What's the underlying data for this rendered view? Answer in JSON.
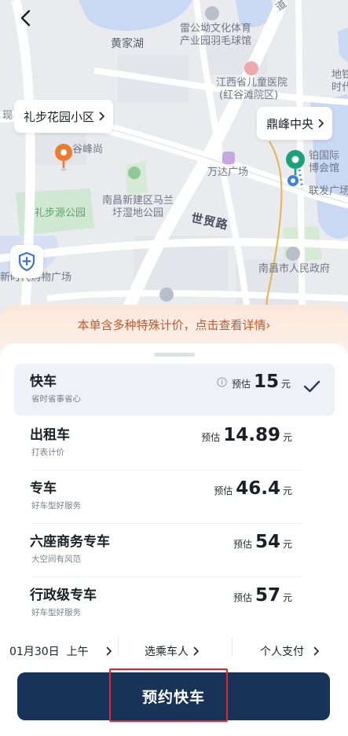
{
  "map": {
    "labels": {
      "huangjiahu": "黄家湖",
      "leigong_line1": "雷公坳文化体育",
      "leigong_line2": "产业园羽毛球馆",
      "hospital_line1": "江西省儿童医院",
      "hospital_line2": "(红谷滩院区)",
      "ditie_line1": "地铁",
      "ditie_line2": "时代",
      "xian": "现",
      "gufeng": "谷峰尚",
      "wanda": "万达广场",
      "expo_line1": "铂国际",
      "expo_line2": "博会馆",
      "lianfa": "联发广场",
      "wetland_line1": "南昌新建区马兰",
      "wetland_line2": "圩湿地公园",
      "shimao": "世贸路",
      "lbpark": "礼步源公园",
      "plaza": "新时代购物广场",
      "gov": "南昌市人民政府",
      "top_road": "道"
    },
    "origin_chip": "礼步花园小区",
    "dest_chip": "鼎峰中央"
  },
  "promo": {
    "text": "本单含多种特殊计价，点击查看详情",
    "chevron": "›"
  },
  "rides": [
    {
      "name": "快车",
      "sub": "省时省事省心",
      "est": "预估",
      "price": "15",
      "unit": "元",
      "selected": true
    },
    {
      "name": "出租车",
      "sub": "打表计价",
      "est": "预估",
      "price": "14.89",
      "unit": "元",
      "selected": false
    },
    {
      "name": "专车",
      "sub": "好车型好服务",
      "est": "预估",
      "price": "46.4",
      "unit": "元",
      "selected": false
    },
    {
      "name": "六座商务专车",
      "sub": "大空间有风范",
      "est": "预估",
      "price": "54",
      "unit": "元",
      "selected": false
    },
    {
      "name": "行政级专车",
      "sub": "好车型好服务",
      "est": "预估",
      "price": "57",
      "unit": "元",
      "selected": false
    }
  ],
  "options": {
    "date": "01月30日",
    "period": "上午",
    "passenger": "选乘车人",
    "payment": "个人支付"
  },
  "cta": {
    "label": "预约快车"
  },
  "colors": {
    "accent": "#173458",
    "promo_text": "#c1582a",
    "origin_pin": "#f07a2d",
    "dest_pin": "#1aa37a",
    "highlight": "#e2262b"
  },
  "icons": {
    "back": "back-arrow-icon",
    "shield": "shield-icon",
    "origin": "origin-pin-icon",
    "dest": "destination-pin-icon",
    "check": "check-icon",
    "info": "info-icon",
    "chevron": "chevron-right-icon"
  }
}
